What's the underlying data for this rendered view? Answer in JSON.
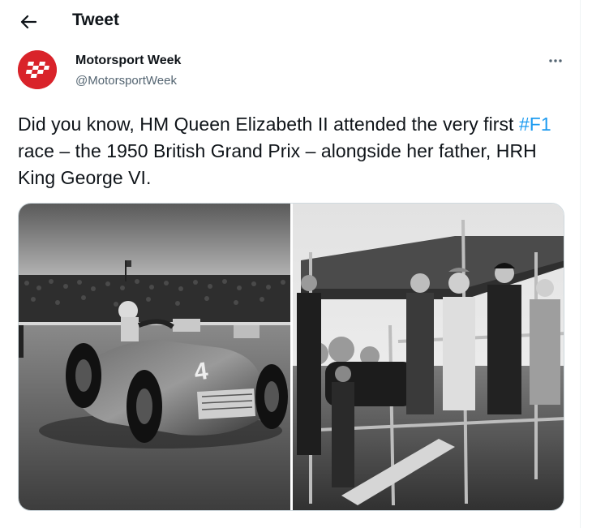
{
  "header": {
    "title": "Tweet",
    "back_icon": "arrow-left-icon"
  },
  "author": {
    "name": "Motorsport Week",
    "handle": "@MotorsportWeek",
    "avatar_color": "#d9232a"
  },
  "tweet": {
    "text_before": "Did you know, HM Queen Elizabeth II attended the very first ",
    "hashtag": "#F1",
    "text_after": " race – the 1950 British Grand Prix – alongside her father, HRH King George VI.",
    "hashtag_color": "#1d9bf0"
  },
  "media": {
    "photos": [
      {
        "name": "race-car-photo",
        "icon": "photo"
      },
      {
        "name": "royal-stand-photo",
        "icon": "photo"
      }
    ]
  },
  "colors": {
    "text": "#0f1419",
    "secondary": "#536471",
    "border": "#cfd9de"
  }
}
